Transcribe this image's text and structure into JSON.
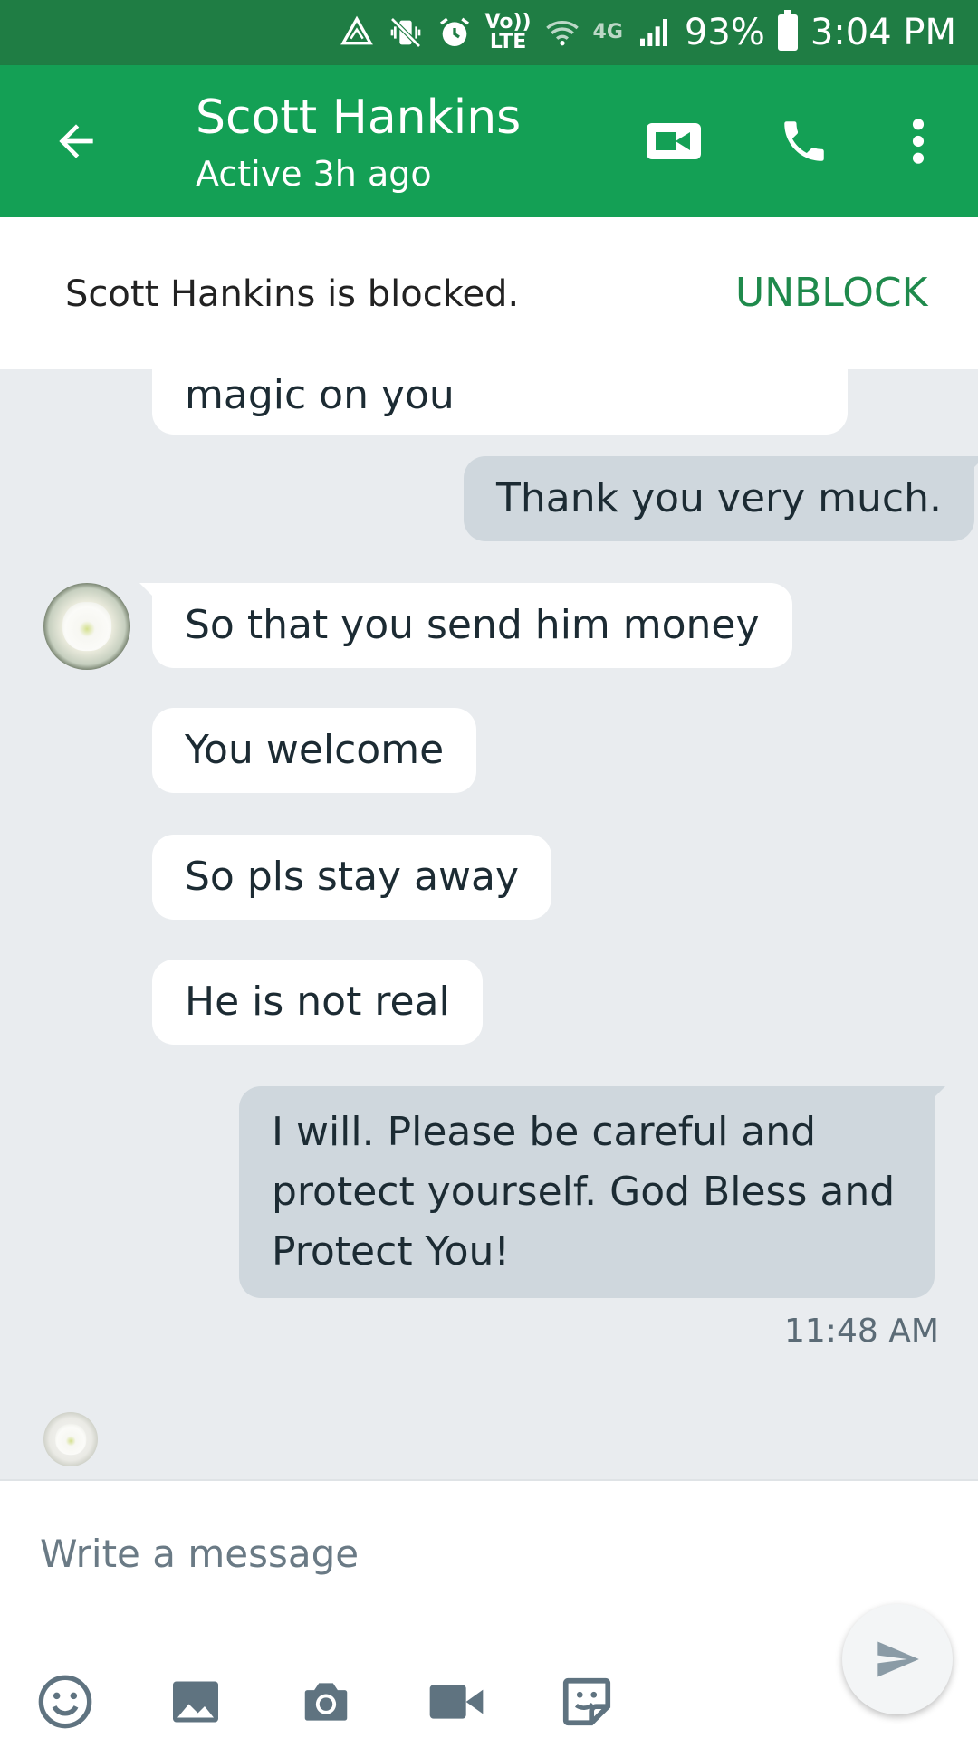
{
  "status_bar": {
    "volte_label_top": "Vo))",
    "volte_label_bottom": "LTE",
    "network_label": "4G",
    "battery": "93%",
    "time": "3:04 PM"
  },
  "header": {
    "contact_name": "Scott Hankins",
    "contact_status": "Active 3h ago",
    "icons": [
      "back-arrow-icon",
      "video-camera-icon",
      "phone-icon",
      "more-vert-icon"
    ]
  },
  "banner": {
    "text": "Scott Hankins is blocked.",
    "action_label": "UNBLOCK"
  },
  "messages": [
    {
      "direction": "in",
      "text": "magic on you"
    },
    {
      "direction": "out",
      "text": "Thank you very much."
    },
    {
      "direction": "in",
      "text": "So that you send him money"
    },
    {
      "direction": "in",
      "text": "You welcome"
    },
    {
      "direction": "in",
      "text": "So pls stay away"
    },
    {
      "direction": "in",
      "text": "He is not real"
    },
    {
      "direction": "out",
      "text": "I will. Please be careful and protect yourself. God Bless and Protect You!"
    }
  ],
  "last_timestamp": "11:48 AM",
  "composer": {
    "placeholder": "Write a message",
    "tools": [
      "emoji-icon",
      "image-icon",
      "camera-icon",
      "video-icon",
      "sticker-icon"
    ],
    "send_icon": "send-icon"
  },
  "colors": {
    "status_bar": "#1f7d44",
    "app_bar": "#14a055",
    "unblock": "#1f8a4c",
    "outgoing_bubble": "#cfd7dd",
    "incoming_bubble": "#ffffff",
    "thread_bg": "#e9ecef"
  }
}
